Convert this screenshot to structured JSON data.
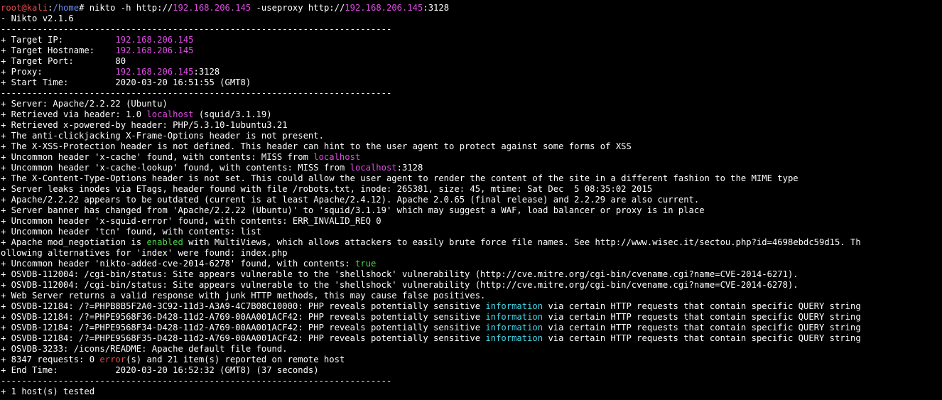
{
  "colors": {
    "background": "#000000",
    "text": "#ffffff",
    "prompt_user": "#e04b4b",
    "prompt_path": "#6c8ef5",
    "highlight_ip": "#e04ce4",
    "highlight_green": "#4cd84c",
    "highlight_cyan": "#44d8e8"
  },
  "lines": [
    [
      {
        "t": "root@kali",
        "c": "red"
      },
      {
        "t": ":",
        "c": "white"
      },
      {
        "t": "/home",
        "c": "blue"
      },
      {
        "t": "# nikto -h http://",
        "c": "white"
      },
      {
        "t": "192.168.206.145",
        "c": "magenta"
      },
      {
        "t": " -useproxy http://",
        "c": "white"
      },
      {
        "t": "192.168.206.145",
        "c": "magenta"
      },
      {
        "t": ":3128",
        "c": "white"
      }
    ],
    [
      {
        "t": "- Nikto v2.1.6",
        "c": "white"
      }
    ],
    [
      {
        "t": "---------------------------------------------------------------------------",
        "c": "white"
      }
    ],
    [
      {
        "t": "+ Target IP:          ",
        "c": "white"
      },
      {
        "t": "192.168.206.145",
        "c": "magenta"
      }
    ],
    [
      {
        "t": "+ Target Hostname:    ",
        "c": "white"
      },
      {
        "t": "192.168.206.145",
        "c": "magenta"
      }
    ],
    [
      {
        "t": "+ Target Port:        80",
        "c": "white"
      }
    ],
    [
      {
        "t": "+ Proxy:              ",
        "c": "white"
      },
      {
        "t": "192.168.206.145",
        "c": "magenta"
      },
      {
        "t": ":3128",
        "c": "white"
      }
    ],
    [
      {
        "t": "+ Start Time:         2020-03-20 16:51:55 (GMT8)",
        "c": "white"
      }
    ],
    [
      {
        "t": "---------------------------------------------------------------------------",
        "c": "white"
      }
    ],
    [
      {
        "t": "+ Server: Apache/2.2.22 (Ubuntu)",
        "c": "white"
      }
    ],
    [
      {
        "t": "+ Retrieved via header: 1.0 ",
        "c": "white"
      },
      {
        "t": "localhost",
        "c": "magenta"
      },
      {
        "t": " (squid/3.1.19)",
        "c": "white"
      }
    ],
    [
      {
        "t": "+ Retrieved x-powered-by header: PHP/5.3.10-1ubuntu3.21",
        "c": "white"
      }
    ],
    [
      {
        "t": "+ The anti-clickjacking X-Frame-Options header is not present.",
        "c": "white"
      }
    ],
    [
      {
        "t": "+ The X-XSS-Protection header is not defined. This header can hint to the user agent to protect against some forms of XSS",
        "c": "white"
      }
    ],
    [
      {
        "t": "+ Uncommon header 'x-cache' found, with contents: MISS from ",
        "c": "white"
      },
      {
        "t": "localhost",
        "c": "magenta"
      }
    ],
    [
      {
        "t": "+ Uncommon header 'x-cache-lookup' found, with contents: MISS from ",
        "c": "white"
      },
      {
        "t": "localhost",
        "c": "magenta"
      },
      {
        "t": ":3128",
        "c": "white"
      }
    ],
    [
      {
        "t": "+ The X-Content-Type-Options header is not set. This could allow the user agent to render the content of the site in a different fashion to the MIME type",
        "c": "white"
      }
    ],
    [
      {
        "t": "+ Server leaks inodes via ETags, header found with file /robots.txt, inode: 265381, size: 45, mtime: Sat Dec  5 08:35:02 2015",
        "c": "white"
      }
    ],
    [
      {
        "t": "+ Apache/2.2.22 appears to be outdated (current is at least Apache/2.4.12). Apache 2.0.65 (final release) and 2.2.29 are also current.",
        "c": "white"
      }
    ],
    [
      {
        "t": "+ Server banner has changed from 'Apache/2.2.22 (Ubuntu)' to 'squid/3.1.19' which may suggest a WAF, load balancer or proxy is in place",
        "c": "white"
      }
    ],
    [
      {
        "t": "+ Uncommon header 'x-squid-error' found, with contents: ERR_INVALID_REQ 0",
        "c": "white"
      }
    ],
    [
      {
        "t": "+ Uncommon header 'tcn' found, with contents: list",
        "c": "white"
      }
    ],
    [
      {
        "t": "+ Apache mod_negotiation is ",
        "c": "white"
      },
      {
        "t": "enabled",
        "c": "green"
      },
      {
        "t": " with MultiViews, which allows attackers to easily brute force file names. See http://www.wisec.it/sectou.php?id=4698ebdc59d15. Th",
        "c": "white"
      }
    ],
    [
      {
        "t": "ollowing alternatives for 'index' were found: index.php",
        "c": "white"
      }
    ],
    [
      {
        "t": "+ Uncommon header 'nikto-added-cve-2014-6278' found, with contents: ",
        "c": "white"
      },
      {
        "t": "true",
        "c": "green"
      }
    ],
    [
      {
        "t": "+ OSVDB-112004: /cgi-bin/status: Site appears vulnerable to the 'shellshock' vulnerability (http://cve.mitre.org/cgi-bin/cvename.cgi?name=CVE-2014-6271).",
        "c": "white"
      }
    ],
    [
      {
        "t": "+ OSVDB-112004: /cgi-bin/status: Site appears vulnerable to the 'shellshock' vulnerability (http://cve.mitre.org/cgi-bin/cvename.cgi?name=CVE-2014-6278).",
        "c": "white"
      }
    ],
    [
      {
        "t": "+ Web Server returns a valid response with junk HTTP methods, this may cause false positives.",
        "c": "white"
      }
    ],
    [
      {
        "t": "+ OSVDB-12184: /?=PHPB8B5F2A0-3C92-11d3-A3A9-4C7B08C10000: PHP reveals potentially sensitive ",
        "c": "white"
      },
      {
        "t": "information",
        "c": "cyan"
      },
      {
        "t": " via certain HTTP requests that contain specific QUERY string",
        "c": "white"
      }
    ],
    [
      {
        "t": "+ OSVDB-12184: /?=PHPE9568F36-D428-11d2-A769-00AA001ACF42: PHP reveals potentially sensitive ",
        "c": "white"
      },
      {
        "t": "information",
        "c": "cyan"
      },
      {
        "t": " via certain HTTP requests that contain specific QUERY string",
        "c": "white"
      }
    ],
    [
      {
        "t": "+ OSVDB-12184: /?=PHPE9568F34-D428-11d2-A769-00AA001ACF42: PHP reveals potentially sensitive ",
        "c": "white"
      },
      {
        "t": "information",
        "c": "cyan"
      },
      {
        "t": " via certain HTTP requests that contain specific QUERY string",
        "c": "white"
      }
    ],
    [
      {
        "t": "+ OSVDB-12184: /?=PHPE9568F35-D428-11d2-A769-00AA001ACF42: PHP reveals potentially sensitive ",
        "c": "white"
      },
      {
        "t": "information",
        "c": "cyan"
      },
      {
        "t": " via certain HTTP requests that contain specific QUERY string",
        "c": "white"
      }
    ],
    [
      {
        "t": "+ OSVDB-3233: /icons/README: Apache default file found.",
        "c": "white"
      }
    ],
    [
      {
        "t": "+ 8347 requests: 0 ",
        "c": "white"
      },
      {
        "t": "error",
        "c": "red"
      },
      {
        "t": "(s) and 21 item(s) reported on remote host",
        "c": "white"
      }
    ],
    [
      {
        "t": "+ End Time:           2020-03-20 16:52:32 (GMT8) (37 seconds)",
        "c": "white"
      }
    ],
    [
      {
        "t": "---------------------------------------------------------------------------",
        "c": "white"
      }
    ],
    [
      {
        "t": "+ 1 host(s) tested",
        "c": "white"
      }
    ]
  ]
}
